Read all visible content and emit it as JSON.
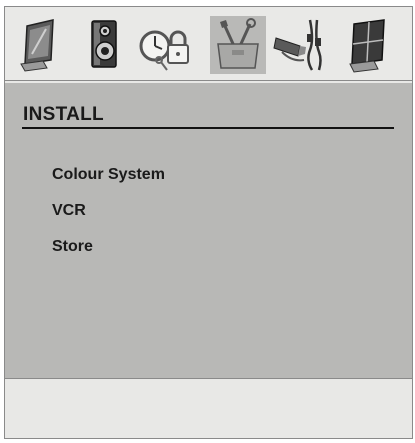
{
  "menu": {
    "title": "INSTALL",
    "items": [
      {
        "label": "Colour System"
      },
      {
        "label": "VCR"
      },
      {
        "label": "Store"
      }
    ]
  },
  "icons": [
    {
      "name": "tv-picture-icon",
      "selected": false
    },
    {
      "name": "speaker-sound-icon",
      "selected": false
    },
    {
      "name": "clock-lock-features-icon",
      "selected": false
    },
    {
      "name": "toolbox-install-icon",
      "selected": true
    },
    {
      "name": "cables-connection-icon",
      "selected": false
    },
    {
      "name": "screen-grid-icon",
      "selected": false
    }
  ],
  "colors": {
    "panel_background": "#b8b8b6",
    "iconbar_background": "#e9e9e7",
    "selected_icon_background": "#b9b9b7",
    "text": "#1a1a1a"
  }
}
